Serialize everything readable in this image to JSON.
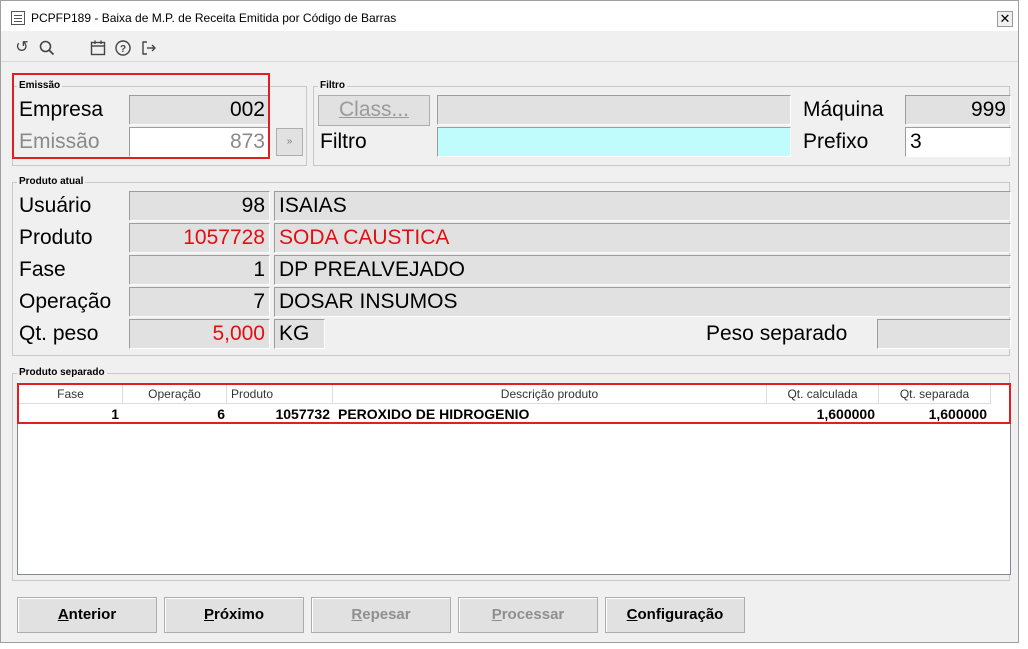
{
  "window": {
    "title": "PCPFP189 - Baixa de M.P. de Receita Emitida por Código de Barras",
    "close_glyph": "✕"
  },
  "toolbar": {
    "icons": [
      "refresh-icon",
      "search-icon",
      "calendar-icon",
      "help-icon",
      "exit-icon"
    ],
    "glyphs": {
      "refresh": "↺",
      "search": "⚲",
      "calendar": "▦",
      "help": "?",
      "exit": "⇥"
    }
  },
  "emissao": {
    "group_title": "Emissão",
    "empresa_label": "Empresa",
    "empresa_value": "002",
    "emissao_label": "Emissão",
    "emissao_value": "873",
    "picker_glyph": "»"
  },
  "filtro": {
    "group_title": "Filtro",
    "class_button": "Class...",
    "class_value": "",
    "filtro_label": "Filtro",
    "filtro_value": "",
    "maquina_label": "Máquina",
    "maquina_value": "999",
    "prefixo_label": "Prefixo",
    "prefixo_value": "3"
  },
  "produto_atual": {
    "group_title": "Produto atual",
    "usuario_label": "Usuário",
    "usuario_code": "98",
    "usuario_name": "ISAIAS",
    "produto_label": "Produto",
    "produto_code": "1057728",
    "produto_name": "SODA CAUSTICA",
    "fase_label": "Fase",
    "fase_code": "1",
    "fase_name": "DP PREALVEJADO",
    "operacao_label": "Operação",
    "operacao_code": "7",
    "operacao_name": "DOSAR INSUMOS",
    "qtpeso_label": "Qt. peso",
    "qtpeso_value": "5,000",
    "qtpeso_unit": "KG",
    "peso_separado_label": "Peso separado",
    "peso_separado_value": ""
  },
  "produto_separado": {
    "group_title": "Produto separado",
    "columns": [
      "Fase",
      "Operação",
      "Produto",
      "Descrição produto",
      "Qt. calculada",
      "Qt. separada"
    ],
    "rows": [
      {
        "fase": "1",
        "operacao": "6",
        "produto": "1057732",
        "descricao": "PEROXIDO DE HIDROGENIO",
        "qt_calculada": "1,600000",
        "qt_separada": "1,600000"
      }
    ]
  },
  "buttons": {
    "anterior": {
      "first": "A",
      "rest": "nterior",
      "enabled": true
    },
    "proximo": {
      "first": "P",
      "rest": "róximo",
      "enabled": true
    },
    "repesar": {
      "first": "R",
      "rest": "epesar",
      "enabled": false
    },
    "processar": {
      "first": "P",
      "rest": "rocessar",
      "enabled": false
    },
    "configuracao": {
      "first": "C",
      "rest": "onfiguração",
      "enabled": true
    }
  },
  "colors": {
    "highlight_box": "#e02020",
    "alert_text": "#e01010",
    "filter_field": "#c0fcfc"
  }
}
